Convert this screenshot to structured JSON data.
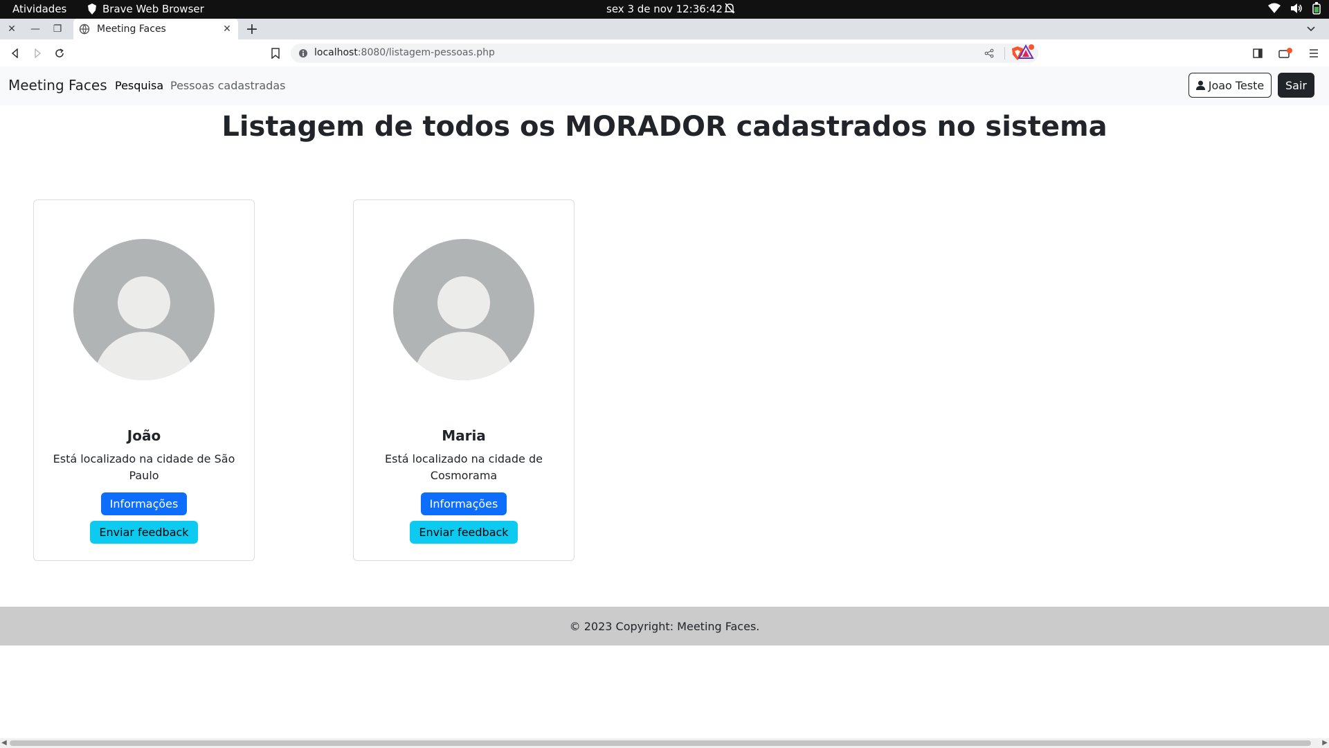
{
  "os": {
    "activities": "Atividades",
    "app_name": "Brave Web Browser",
    "datetime": "sex 3 de nov  12:36:42"
  },
  "browser": {
    "tab_title": "Meeting Faces",
    "url_host": "localhost",
    "url_rest": ":8080/listagem-pessoas.php"
  },
  "navbar": {
    "brand": "Meeting Faces",
    "links": [
      "Pesquisa",
      "Pessoas cadastradas"
    ],
    "user_button": "Joao Teste",
    "logout_button": "Sair"
  },
  "page": {
    "title": "Listagem de todos os MORADOR cadastrados no sistema"
  },
  "people": [
    {
      "name": "João",
      "city": "Está localizado na cidade de São Paulo",
      "info_button": "Informações",
      "feedback_button": "Enviar feedback"
    },
    {
      "name": "Maria",
      "city": "Está localizado na cidade de Cosmorama",
      "info_button": "Informações",
      "feedback_button": "Enviar feedback"
    }
  ],
  "footer": {
    "text": "© 2023 Copyright: Meeting Faces."
  },
  "colors": {
    "primary": "#0d6efd",
    "info": "#0dcaf0",
    "dark": "#212529",
    "avatar_bg": "#b1b4b5",
    "avatar_fg": "#ececeb"
  },
  "icons": {
    "os_tray": [
      "wifi-icon",
      "volume-icon",
      "battery-icon"
    ],
    "toolbar": [
      "back-icon",
      "forward-icon",
      "reload-icon",
      "bookmark-icon",
      "share-icon",
      "brave-shield-icon",
      "brave-rewards-icon",
      "sidebar-icon",
      "wallet-icon",
      "menu-icon"
    ]
  }
}
